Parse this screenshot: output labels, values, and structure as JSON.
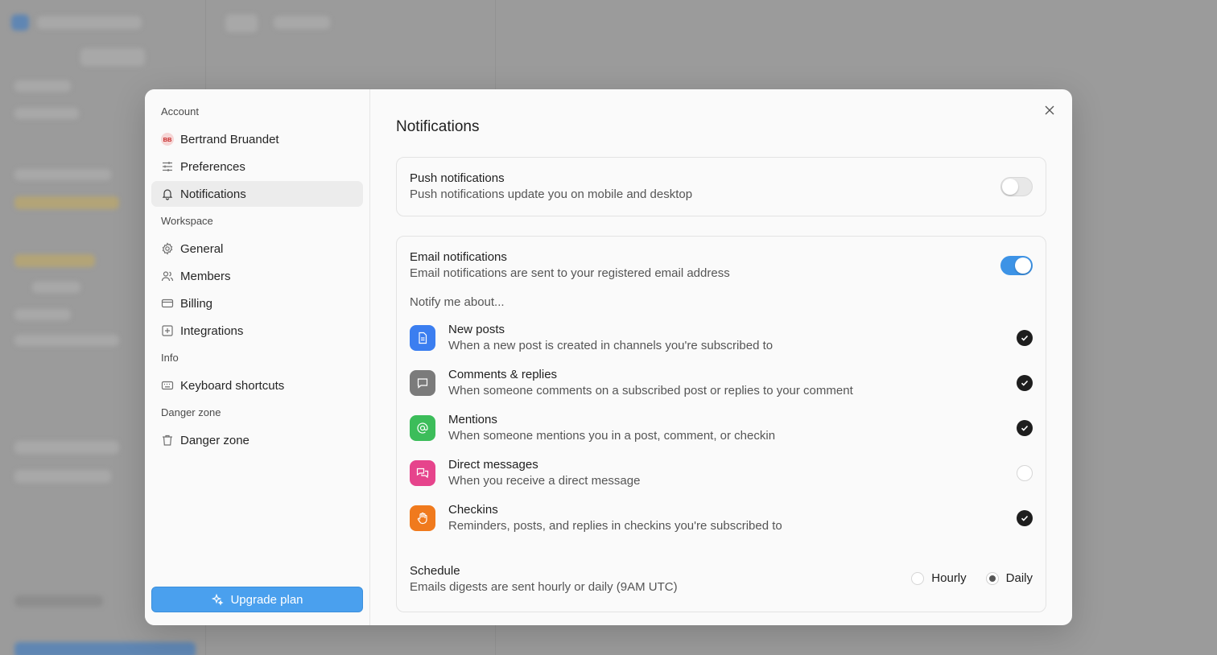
{
  "sidebar": {
    "sections": [
      {
        "label": "Account",
        "items": [
          {
            "label": "Bertrand Bruandet",
            "icon": "avatar",
            "initials": "BB"
          },
          {
            "label": "Preferences",
            "icon": "sliders-icon"
          },
          {
            "label": "Notifications",
            "icon": "bell-icon",
            "active": true
          }
        ]
      },
      {
        "label": "Workspace",
        "items": [
          {
            "label": "General",
            "icon": "gear-icon"
          },
          {
            "label": "Members",
            "icon": "users-icon"
          },
          {
            "label": "Billing",
            "icon": "credit-card-icon"
          },
          {
            "label": "Integrations",
            "icon": "plus-square-icon"
          }
        ]
      },
      {
        "label": "Info",
        "items": [
          {
            "label": "Keyboard shortcuts",
            "icon": "keyboard-icon"
          }
        ]
      },
      {
        "label": "Danger zone",
        "items": [
          {
            "label": "Danger zone",
            "icon": "trash-icon"
          }
        ]
      }
    ],
    "upgrade_label": "Upgrade plan"
  },
  "main": {
    "title": "Notifications",
    "push": {
      "title": "Push notifications",
      "desc": "Push notifications update you on mobile and desktop",
      "enabled": false
    },
    "email": {
      "title": "Email notifications",
      "desc": "Email notifications are sent to your registered email address",
      "enabled": true,
      "notify_label": "Notify me about...",
      "items": [
        {
          "title": "New posts",
          "desc": "When a new post is created in channels you're subscribed to",
          "icon": "document-icon",
          "color": "#3b7ef0",
          "checked": true
        },
        {
          "title": "Comments & replies",
          "desc": "When someone comments on a subscribed post or replies to your comment",
          "icon": "comment-icon",
          "color": "#7b7b7b",
          "checked": true
        },
        {
          "title": "Mentions",
          "desc": "When someone mentions you in a post, comment, or checkin",
          "icon": "at-icon",
          "color": "#3cbd5a",
          "checked": true
        },
        {
          "title": "Direct messages",
          "desc": "When you receive a direct message",
          "icon": "messages-icon",
          "color": "#e6448c",
          "checked": false
        },
        {
          "title": "Checkins",
          "desc": "Reminders, posts, and replies in checkins you're subscribed to",
          "icon": "hand-icon",
          "color": "#f07a1d",
          "checked": true
        }
      ],
      "schedule": {
        "title": "Schedule",
        "desc": "Emails digests are sent hourly or daily (9AM UTC)",
        "options": [
          "Hourly",
          "Daily"
        ],
        "selected": "Daily"
      }
    }
  }
}
